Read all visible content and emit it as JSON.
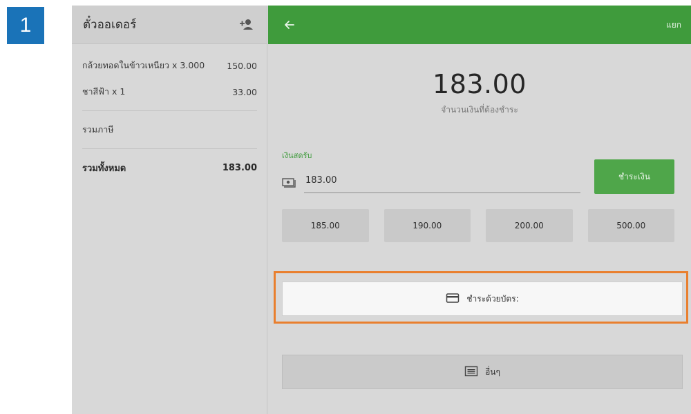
{
  "step": {
    "number": "1"
  },
  "ticket": {
    "title": "ตั๋วออเดอร์",
    "items": [
      {
        "name": "กล้วยทอดในข้าวเหนียว x 3.000",
        "price": "150.00"
      },
      {
        "name": "ชาสีฟ้า x 1",
        "price": "33.00"
      }
    ],
    "tax_label": "รวมภาษี",
    "total_label": "รวมทั้งหมด",
    "total_value": "183.00"
  },
  "payment": {
    "split_label": "แยก",
    "amount_due": "183.00",
    "amount_caption": "จำนวนเงินที่ต้องชำระ",
    "cash_label": "เงินสดรับ",
    "cash_value": "183.00",
    "pay_button": "ชำระเงิน",
    "quick_amounts": [
      "185.00",
      "190.00",
      "200.00",
      "500.00"
    ],
    "card_button": "ชำระด้วยบัตร:",
    "other_button": "อื่นๆ"
  },
  "icons": {
    "add_customer": "person-add-icon",
    "back": "arrow-back-icon",
    "cash": "cash-icon",
    "card": "credit-card-icon",
    "other": "list-icon"
  },
  "colors": {
    "header_green": "#3f9b3c",
    "pay_button": "#4fa64a",
    "highlight": "#e97f2e",
    "step_badge": "#1a73b8"
  }
}
